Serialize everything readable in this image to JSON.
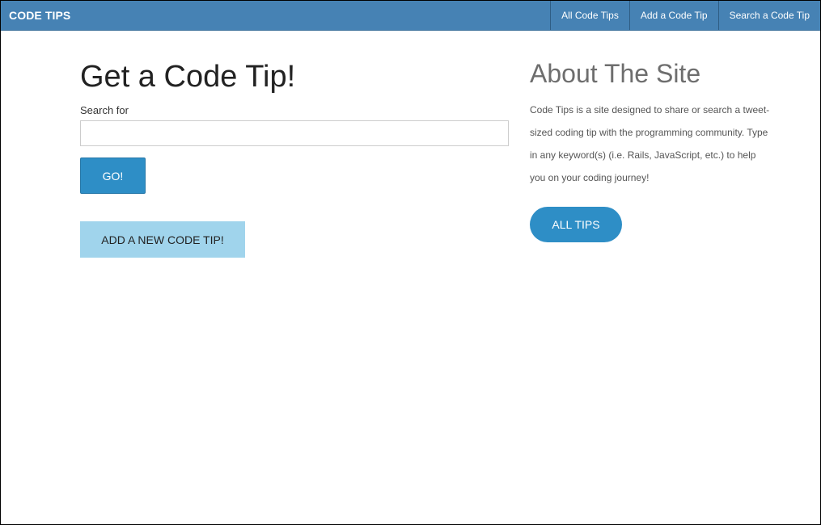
{
  "navbar": {
    "brand": "CODE TIPS",
    "links": [
      {
        "label": "All Code Tips"
      },
      {
        "label": "Add a Code Tip"
      },
      {
        "label": "Search a Code Tip"
      }
    ]
  },
  "search_section": {
    "title": "Get a Code Tip!",
    "label": "Search for",
    "input_value": "",
    "go_label": "GO!",
    "add_tip_label": "ADD A NEW CODE TIP!"
  },
  "about_section": {
    "title": "About The Site",
    "text": "Code Tips is a site designed to share or search a tweet-sized coding tip with the programming community. Type in any keyword(s) (i.e. Rails, JavaScript, etc.) to help you on your coding journey!",
    "all_tips_label": "ALL TIPS"
  },
  "colors": {
    "navbar": "#4682b4",
    "primary_button": "#2e8ec6",
    "secondary_button": "#a0d4ec"
  }
}
